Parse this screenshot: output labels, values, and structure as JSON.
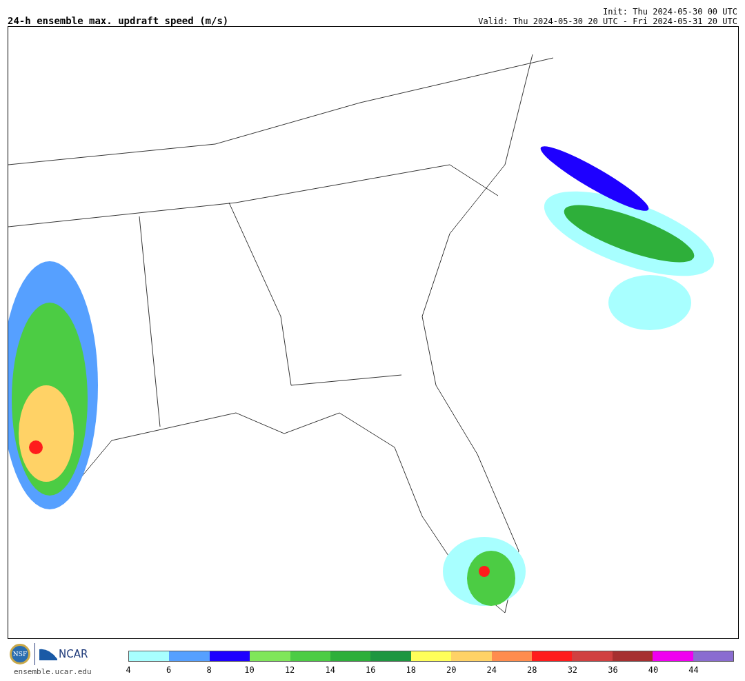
{
  "title": "24-h ensemble max. updraft speed (m/s)",
  "init": "Init: Thu 2024-05-30 00 UTC",
  "valid": "Valid: Thu 2024-05-30 20 UTC - Fri 2024-05-31 20 UTC",
  "footer": {
    "logos": [
      "NSF",
      "NCAR"
    ],
    "site": "ensemble.ucar.edu"
  },
  "colorbar": {
    "segments": [
      {
        "color": "#a8ffff"
      },
      {
        "color": "#56a0ff"
      },
      {
        "color": "#1e00ff"
      },
      {
        "color": "#80e65a"
      },
      {
        "color": "#4ccc44"
      },
      {
        "color": "#2eaf3a"
      },
      {
        "color": "#1e9640"
      },
      {
        "color": "#ffff5a"
      },
      {
        "color": "#ffd266"
      },
      {
        "color": "#ff8c4e"
      },
      {
        "color": "#ff1c1c"
      },
      {
        "color": "#d04040"
      },
      {
        "color": "#a63030"
      },
      {
        "color": "#f000f0"
      },
      {
        "color": "#8a6cd0"
      }
    ],
    "ticks": [
      "4",
      "6",
      "8",
      "10",
      "12",
      "14",
      "16",
      "18",
      "20",
      "24",
      "28",
      "32",
      "36",
      "40",
      "44"
    ]
  }
}
